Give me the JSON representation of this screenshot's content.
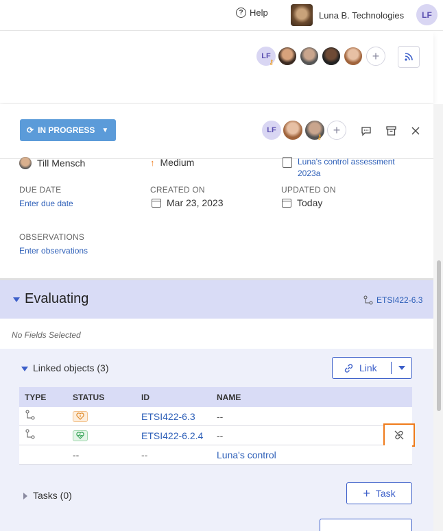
{
  "topbar": {
    "help_label": "Help",
    "org_name": "Luna B. Technologies",
    "user_initials": "LF"
  },
  "background_card": {
    "owner_initials": "LF"
  },
  "panel": {
    "status_label": "IN PROGRESS",
    "header_initials": "LF",
    "assignee": "Till Mensch",
    "priority": "Medium",
    "assessment_link": "Luna's control assessment 2023a",
    "due_date_label": "DUE DATE",
    "due_date_link": "Enter due date",
    "created_label": "CREATED ON",
    "created_value": "Mar 23, 2023",
    "updated_label": "UPDATED ON",
    "updated_value": "Today",
    "observations_label": "OBSERVATIONS",
    "observations_link": "Enter observations"
  },
  "evaluating": {
    "title": "Evaluating",
    "code": "ETSI422-6.3",
    "empty_text": "No Fields Selected"
  },
  "linked": {
    "title": "Linked objects (3)",
    "link_button": "Link",
    "columns": {
      "type": "TYPE",
      "status": "STATUS",
      "id": "ID",
      "name": "NAME"
    },
    "rows": [
      {
        "id": "ETSI422-6.3",
        "name": "--",
        "status_color": "#e08a2a"
      },
      {
        "id": "ETSI422-6.2.4",
        "name": "--",
        "status_color": "#3aa55a"
      },
      {
        "status": "--",
        "id": "--",
        "name": "Luna's control"
      }
    ]
  },
  "tasks": {
    "title": "Tasks (0)",
    "add_button": "Task"
  },
  "colors": {
    "accent": "#3c5fc9",
    "status_bg": "#5b9bd9",
    "section_bg": "#d9dcf6",
    "highlight": "#ef7a1a"
  }
}
